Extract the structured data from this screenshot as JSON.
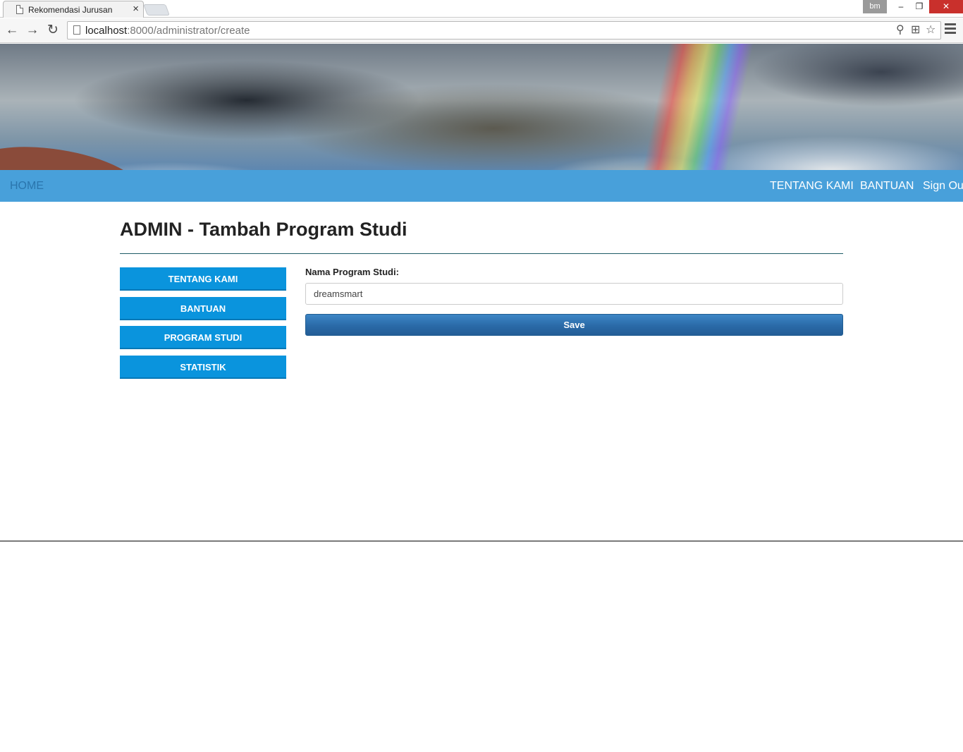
{
  "browser": {
    "tab_title": "Rekomendasi Jurusan",
    "tab_close": "×",
    "user_badge": "bm",
    "url_host": "localhost",
    "url_path": ":8000/administrator/create",
    "window": {
      "minimize": "–",
      "restore": "❐",
      "close": "✕"
    },
    "nav": {
      "back": "←",
      "forward": "→",
      "reload": "↻"
    },
    "omnibox_icons": {
      "zoom": "⚲",
      "translate": "⊞",
      "bookmark": "☆"
    }
  },
  "navbar": {
    "home": "HOME",
    "right_items": [
      "TENTANG KAMI",
      "BANTUAN",
      "Sign Out"
    ]
  },
  "page": {
    "title": "ADMIN - Tambah Program Studi"
  },
  "sidebar": {
    "items": [
      {
        "label": "TENTANG KAMI"
      },
      {
        "label": "BANTUAN"
      },
      {
        "label": "PROGRAM STUDI"
      },
      {
        "label": "STATISTIK"
      }
    ]
  },
  "form": {
    "label": "Nama Program Studi:",
    "value": "dreamsmart",
    "save_label": "Save"
  },
  "colors": {
    "navbar": "#48a0da",
    "sidebar_button": "#0a94dd",
    "save_button": "#2a6aa7"
  }
}
